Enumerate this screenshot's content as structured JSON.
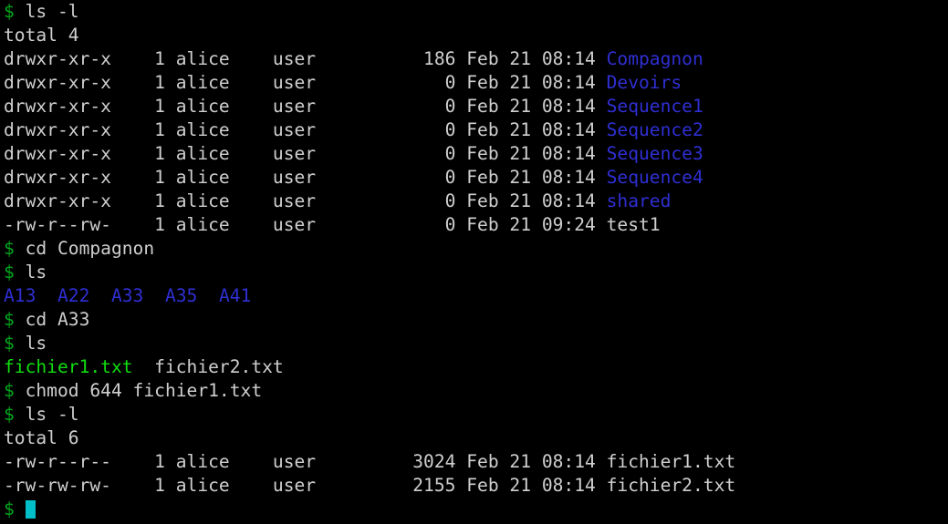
{
  "terminal": {
    "background_color": "#000000",
    "prompt_symbol": "$",
    "colors": {
      "default_text": "#cfcfcf",
      "prompt_green": "#00a81c",
      "directory_blue": "#2f2fd4",
      "executable_green": "#11dd11",
      "cursor_cyan": "#00bfc8"
    },
    "lines": [
      {
        "id": "l1",
        "type": "command",
        "prompt": "$",
        "text": " ls -l"
      },
      {
        "id": "l2",
        "type": "output",
        "text": "total 4"
      },
      {
        "id": "l3",
        "type": "listing",
        "text": "drwxr-xr-x    1 alice    user          186 Feb 21 08:14 ",
        "name": "Compagnon",
        "name_color": "dir"
      },
      {
        "id": "l4",
        "type": "listing",
        "text": "drwxr-xr-x    1 alice    user            0 Feb 21 08:14 ",
        "name": "Devoirs",
        "name_color": "dir"
      },
      {
        "id": "l5",
        "type": "listing",
        "text": "drwxr-xr-x    1 alice    user            0 Feb 21 08:14 ",
        "name": "Sequence1",
        "name_color": "dir"
      },
      {
        "id": "l6",
        "type": "listing",
        "text": "drwxr-xr-x    1 alice    user            0 Feb 21 08:14 ",
        "name": "Sequence2",
        "name_color": "dir"
      },
      {
        "id": "l7",
        "type": "listing",
        "text": "drwxr-xr-x    1 alice    user            0 Feb 21 08:14 ",
        "name": "Sequence3",
        "name_color": "dir"
      },
      {
        "id": "l8",
        "type": "listing",
        "text": "drwxr-xr-x    1 alice    user            0 Feb 21 08:14 ",
        "name": "Sequence4",
        "name_color": "dir"
      },
      {
        "id": "l9",
        "type": "listing",
        "text": "drwxr-xr-x    1 alice    user            0 Feb 21 08:14 ",
        "name": "shared",
        "name_color": "dir"
      },
      {
        "id": "l10",
        "type": "listing",
        "text": "-rw-r--rw-    1 alice    user            0 Feb 21 09:24 ",
        "name": "test1",
        "name_color": "default"
      },
      {
        "id": "l11",
        "type": "command",
        "prompt": "$",
        "text": " cd Compagnon"
      },
      {
        "id": "l12",
        "type": "command",
        "prompt": "$",
        "text": " ls"
      },
      {
        "id": "l13",
        "type": "names",
        "items": [
          "A13",
          "A22",
          "A33",
          "A35",
          "A41"
        ],
        "separator": "  ",
        "color": "dir"
      },
      {
        "id": "l14",
        "type": "command",
        "prompt": "$",
        "text": " cd A33"
      },
      {
        "id": "l15",
        "type": "command",
        "prompt": "$",
        "text": " ls"
      },
      {
        "id": "l16",
        "type": "names2",
        "first": "fichier1.txt",
        "first_color": "exec",
        "separator": "  ",
        "second": "fichier2.txt",
        "second_color": "default"
      },
      {
        "id": "l17",
        "type": "command",
        "prompt": "$",
        "text": " chmod 644 fichier1.txt"
      },
      {
        "id": "l18",
        "type": "command",
        "prompt": "$",
        "text": " ls -l"
      },
      {
        "id": "l19",
        "type": "output",
        "text": "total 6"
      },
      {
        "id": "l20",
        "type": "listing",
        "text": "-rw-r--r--    1 alice    user         3024 Feb 21 08:14 ",
        "name": "fichier1.txt",
        "name_color": "default"
      },
      {
        "id": "l21",
        "type": "listing",
        "text": "-rw-rw-rw-    1 alice    user         2155 Feb 21 08:14 ",
        "name": "fichier2.txt",
        "name_color": "default"
      },
      {
        "id": "l22",
        "type": "cursor",
        "prompt": "$",
        "text": " "
      }
    ]
  },
  "session": {
    "user": "alice",
    "group": "user",
    "commands_run": [
      "ls -l",
      "cd Compagnon",
      "ls",
      "cd A33",
      "ls",
      "chmod 644 fichier1.txt",
      "ls -l"
    ]
  }
}
